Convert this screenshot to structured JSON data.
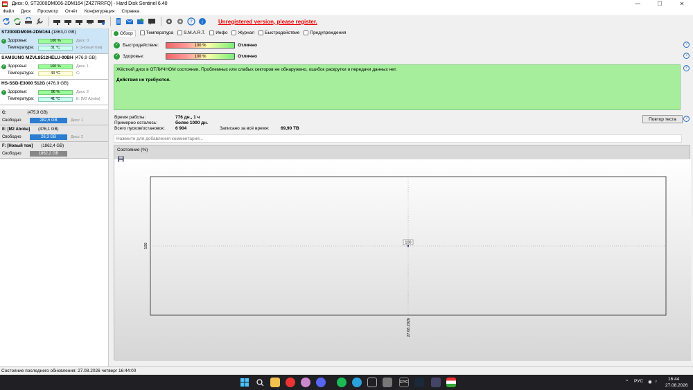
{
  "window": {
    "title": "Диск: 0, ST2000DM006-2DM164 [Z4Z7RRFQ]  -  Hard Disk Sentinel 6.40",
    "minimize": "—",
    "maximize": "☐",
    "close": "✕"
  },
  "menu": [
    "Файл",
    "Диск",
    "Просмотр",
    "Отчёт",
    "Конфигурация",
    "Справка"
  ],
  "toolbar": {
    "unregistered": "Unregistered version, please register."
  },
  "disks": [
    {
      "name": "ST2000DM006-2DM164",
      "size": "(1863,0 GB)",
      "health_label": "Здоровье:",
      "health": "100 %",
      "health_extra": "Диск: 0",
      "temp_label": "Температура:",
      "temp": "31 °C",
      "temp_extra": "F: [Новый том]"
    },
    {
      "name": "SAMSUNG MZVL8512HELU-00BH",
      "size": "(476,9 GB)",
      "health_label": "Здоровье:",
      "health": "100 %",
      "health_extra": "Диск: 1",
      "temp_label": "Температура:",
      "temp": "43 °C",
      "temp_extra": "C:"
    },
    {
      "name": "HS-SSD-E3000 512G",
      "size": "(476,9 GB)",
      "health_label": "Здоровье:",
      "health": "96 %",
      "health_extra": "Диск: 2",
      "temp_label": "Температура:",
      "temp": "41 °C",
      "temp_extra": "E: [M2 Aboba]"
    }
  ],
  "volumes": [
    {
      "name": "C:",
      "size": "(475,9 GB)",
      "free_label": "Свободно",
      "free": "282,5 GB",
      "extra": "Диск: 1"
    },
    {
      "name": "E: [M2 Aboba]",
      "size": "(476,1 GB)",
      "free_label": "Свободно",
      "free": "26,3 GB",
      "extra": "Диск: 2"
    },
    {
      "name": "F: [Новый том]",
      "size": "(1862,4 GB)",
      "free_label": "Свободно",
      "free": "1862,2 GB",
      "extra": ""
    }
  ],
  "tabs": [
    "Обзор",
    "Температура",
    "S.M.A.R.T.",
    "Инфо",
    "Журнал",
    "Быстродействие",
    "Предупреждения"
  ],
  "status": {
    "perf_label": "Быстродействие:",
    "perf_value": "100 %",
    "perf_text": "Отлично",
    "health_label": "Здоровье:",
    "health_value": "100 %",
    "health_text": "Отлично"
  },
  "message": {
    "line1": "Жёсткий диск в ОТЛИЧНОМ состоянии. Проблемных или слабых секторов не обнаружено, ошибок раскрутки и передачи данных нет.",
    "line2": "Действия не требуются."
  },
  "info": {
    "uptime_label": "Время работы:",
    "uptime": "776 дн., 1 ч",
    "remaining_label": "Примерно осталось:",
    "remaining": "более 1000 дн.",
    "starts_label": "Всего пусков/остановок:",
    "starts": "6 904",
    "written_label": "Записано за всё время:",
    "written": "69,90 TB"
  },
  "retest_button": "Повтор теста",
  "comment_placeholder": "Нажмите для добавления комментария...",
  "chart_data": {
    "type": "line",
    "title": "Состояние (%)",
    "x": [
      "27.08.2026"
    ],
    "series": [
      {
        "values": [
          100
        ]
      }
    ],
    "ylabel": "",
    "y_tick": "100",
    "data_label": "100"
  },
  "statusbar": "Состояние последнего обновления: 27.08.2026 четверг 16:44:00",
  "tray": {
    "lang": "РУС",
    "time": "16:44",
    "date": "27.08.2026"
  }
}
